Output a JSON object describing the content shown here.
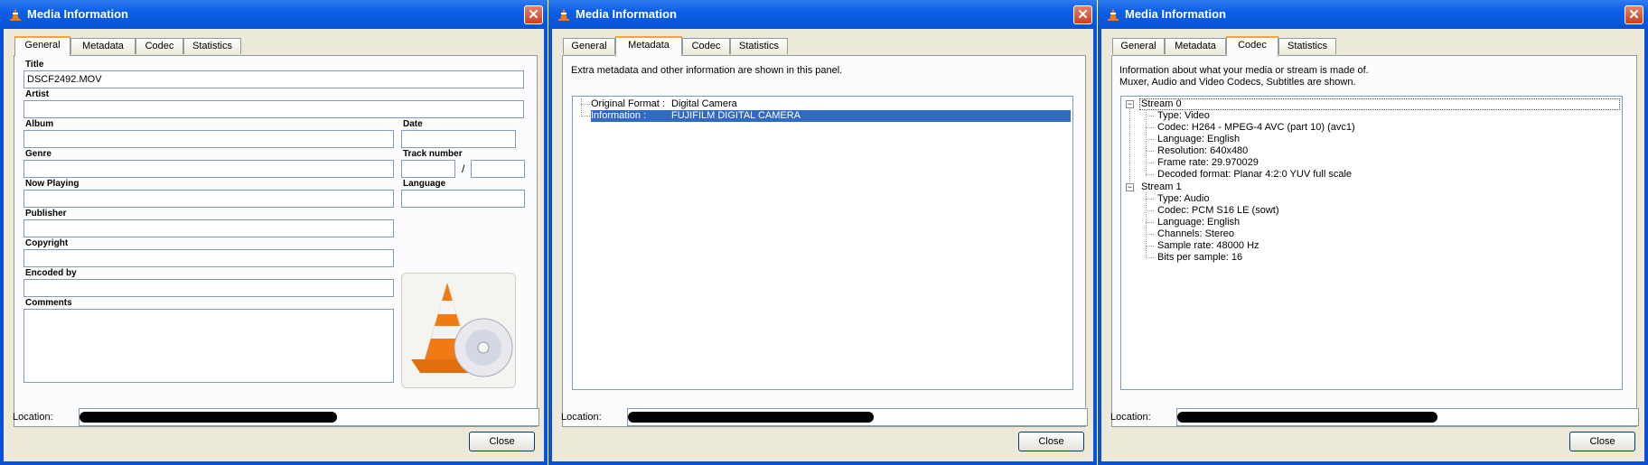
{
  "windows": [
    {
      "title": "Media Information",
      "tabs": [
        "General",
        "Metadata",
        "Codec",
        "Statistics"
      ],
      "active_tab": "General",
      "general": {
        "title_label": "Title",
        "title_value": "DSCF2492.MOV",
        "artist_label": "Artist",
        "album_label": "Album",
        "date_label": "Date",
        "genre_label": "Genre",
        "track_label": "Track number",
        "track_sep": "/",
        "now_playing_label": "Now Playing",
        "language_label": "Language",
        "publisher_label": "Publisher",
        "copyright_label": "Copyright",
        "encoded_by_label": "Encoded by",
        "comments_label": "Comments"
      },
      "location_label": "Location:",
      "close_label": "Close"
    },
    {
      "title": "Media Information",
      "tabs": [
        "General",
        "Metadata",
        "Codec",
        "Statistics"
      ],
      "active_tab": "Metadata",
      "metadata": {
        "description": "Extra metadata and other information are shown in this panel.",
        "rows": [
          {
            "key": "Original Format :",
            "value": "Digital Camera",
            "selected": false
          },
          {
            "key": "Information :",
            "value": "FUJIFILM DIGITAL CAMERA",
            "selected": true
          }
        ]
      },
      "location_label": "Location:",
      "close_label": "Close"
    },
    {
      "title": "Media Information",
      "tabs": [
        "General",
        "Metadata",
        "Codec",
        "Statistics"
      ],
      "active_tab": "Codec",
      "codec": {
        "description_line1": "Information about what your media or stream is made of.",
        "description_line2": "Muxer, Audio and Video Codecs, Subtitles are shown.",
        "streams": [
          {
            "name": "Stream 0",
            "items": [
              "Type: Video",
              "Codec: H264 - MPEG-4 AVC (part 10) (avc1)",
              "Language: English",
              "Resolution: 640x480",
              "Frame rate: 29.970029",
              "Decoded format: Planar 4:2:0 YUV full scale"
            ]
          },
          {
            "name": "Stream 1",
            "items": [
              "Type: Audio",
              "Codec: PCM S16 LE (sowt)",
              "Language: English",
              "Channels: Stereo",
              "Sample rate: 48000 Hz",
              "Bits per sample: 16"
            ]
          }
        ]
      },
      "location_label": "Location:",
      "close_label": "Close"
    }
  ],
  "colors": {
    "titlebar": "#0a5ce6",
    "selection": "#316ac5",
    "tab_highlight": "#f7a731",
    "dialog_bg": "#ece9d8"
  }
}
